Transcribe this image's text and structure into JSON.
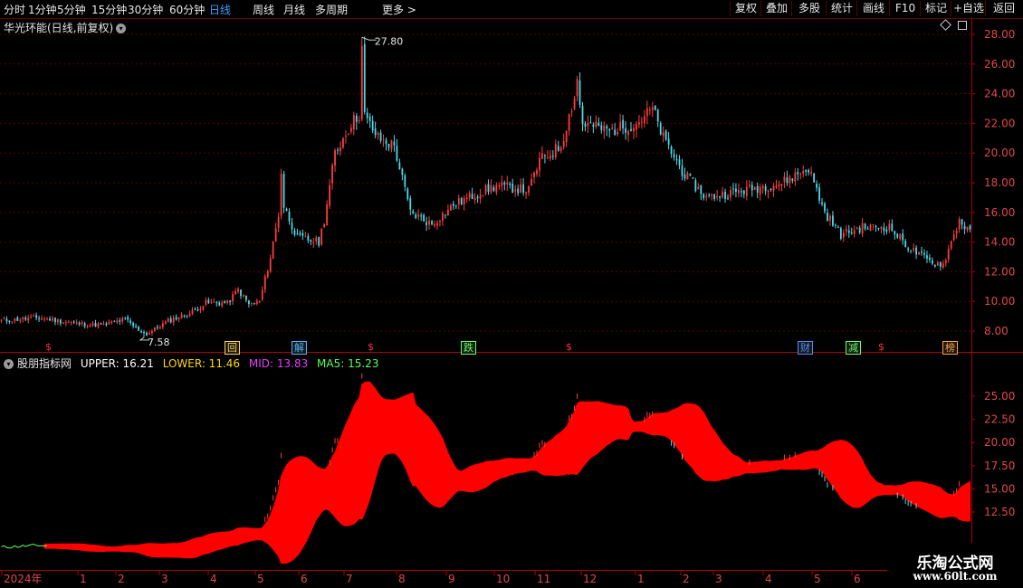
{
  "toolbar": {
    "periods": [
      "分时",
      "1分钟",
      "5分钟",
      "15分钟",
      "30分钟",
      "60分钟",
      "日线",
      "周线",
      "月线",
      "多周期",
      "更多 >"
    ],
    "active": "日线",
    "right_buttons": [
      "复权",
      "叠加",
      "多股",
      "统计",
      "画线",
      "F10",
      "标记",
      "+自选",
      "返回"
    ]
  },
  "chart": {
    "title": "华光环能(日线,前复权)",
    "high_label": "27.80",
    "low_label": "7.58",
    "price_ticks": [
      "28.00",
      "26.00",
      "24.00",
      "22.00",
      "20.00",
      "18.00",
      "16.00",
      "14.00",
      "12.00",
      "10.00",
      "8.00"
    ],
    "colors": {
      "up": "#ff3c3c",
      "down": "#4dd9e8",
      "axis": "#b00000",
      "grid": "#5a0000"
    }
  },
  "badges": [
    {
      "label": "$",
      "color": "#ff3333"
    },
    {
      "label": "回",
      "color": "#ffd24a"
    },
    {
      "label": "解",
      "color": "#4ab6ff"
    },
    {
      "label": "$",
      "color": "#ff3333"
    },
    {
      "label": "跌",
      "color": "#5dff5d"
    },
    {
      "label": "$",
      "color": "#ff3333"
    },
    {
      "label": "财",
      "color": "#4a8dff"
    },
    {
      "label": "减",
      "color": "#5dff5d"
    },
    {
      "label": "$",
      "color": "#ff3333"
    },
    {
      "label": "榜",
      "color": "#ff9e3a"
    }
  ],
  "indicator": {
    "name": "股朋指标网",
    "upper_label": "UPPER: 16.21",
    "lower_label": "LOWER: 11.46",
    "mid_label": "MID: 13.83",
    "ma5_label": "MA5: 15.23",
    "ticks": [
      "25.00",
      "22.50",
      "20.00",
      "17.50",
      "15.00",
      "12.50"
    ],
    "colors": {
      "upper": "#ffffff",
      "lower": "#ffd700",
      "mid": "#e040fb",
      "ma5": "#5dff5d",
      "band": "#ff0000"
    }
  },
  "xaxis": [
    "2024年",
    "1",
    "2",
    "3",
    "4",
    "5",
    "6",
    "7",
    "8",
    "9",
    "10",
    "11",
    "12",
    "1",
    "2",
    "3",
    "4",
    "5",
    "6"
  ],
  "brand": {
    "name": "乐淘公式网",
    "url": "www.60lt.com"
  },
  "chart_data": {
    "type": "candlestick",
    "title": "华光环能(日线,前复权)",
    "ylim": [
      7,
      29
    ],
    "close_path": [
      [
        0,
        8.7
      ],
      [
        14,
        8.9
      ],
      [
        28,
        8.5
      ],
      [
        38,
        8.4
      ],
      [
        46,
        8.8
      ],
      [
        50,
        8.2
      ],
      [
        54,
        7.8
      ],
      [
        56,
        8.0
      ],
      [
        62,
        8.7
      ],
      [
        70,
        9.2
      ],
      [
        76,
        9.9
      ],
      [
        84,
        9.9
      ],
      [
        88,
        10.8
      ],
      [
        92,
        9.8
      ],
      [
        96,
        10.0
      ],
      [
        100,
        13.0
      ],
      [
        104,
        16.8
      ],
      [
        110,
        14.3
      ],
      [
        118,
        14.0
      ],
      [
        120,
        15.5
      ],
      [
        124,
        20.0
      ],
      [
        130,
        22.0
      ],
      [
        134,
        22.8
      ],
      [
        140,
        21.0
      ],
      [
        146,
        20.5
      ],
      [
        152,
        16.0
      ],
      [
        160,
        15.2
      ],
      [
        168,
        16.5
      ],
      [
        176,
        17.2
      ],
      [
        184,
        17.8
      ],
      [
        196,
        17.5
      ],
      [
        200,
        19.5
      ],
      [
        208,
        20.5
      ],
      [
        214,
        24.5
      ],
      [
        216,
        22.0
      ],
      [
        226,
        21.5
      ],
      [
        236,
        22.0
      ],
      [
        242,
        23.0
      ],
      [
        246,
        21.0
      ],
      [
        254,
        18.5
      ],
      [
        262,
        17.0
      ],
      [
        276,
        17.5
      ],
      [
        290,
        18.0
      ],
      [
        300,
        19.0
      ],
      [
        306,
        16.0
      ],
      [
        312,
        14.5
      ],
      [
        320,
        15.0
      ],
      [
        330,
        15.0
      ],
      [
        338,
        13.5
      ],
      [
        346,
        12.6
      ],
      [
        350,
        12.5
      ],
      [
        356,
        15.5
      ],
      [
        360,
        14.6
      ]
    ],
    "low_point": 7.58,
    "high_point": 27.8
  }
}
